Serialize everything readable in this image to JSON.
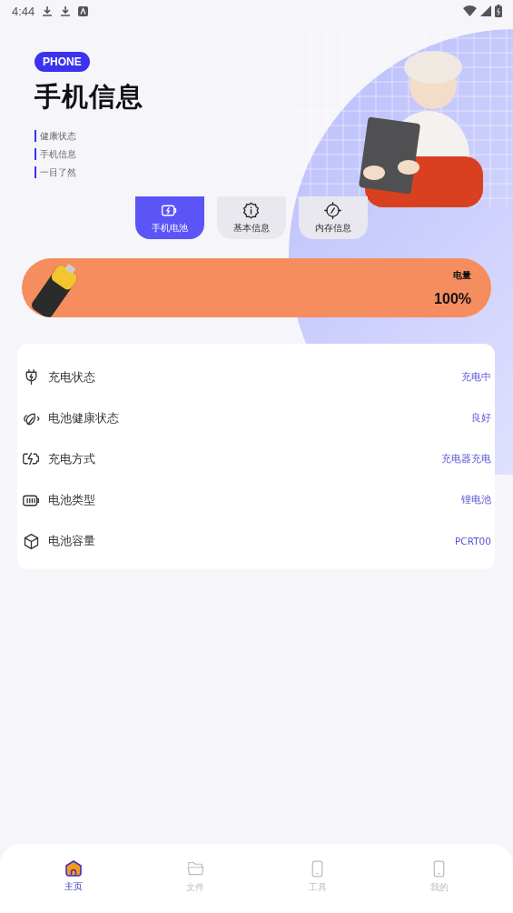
{
  "status_bar": {
    "time": "4:44"
  },
  "hero": {
    "badge": "PHONE",
    "title": "手机信息",
    "bullets": [
      "健康状态",
      "手机信息",
      "一目了然"
    ]
  },
  "tabs": [
    {
      "label": "手机电池",
      "selected": true
    },
    {
      "label": "基本信息",
      "selected": false
    },
    {
      "label": "内存信息",
      "selected": false
    }
  ],
  "battery": {
    "label": "电量",
    "value": "100%"
  },
  "info_rows": [
    {
      "label": "充电状态",
      "value": "充电中"
    },
    {
      "label": "电池健康状态",
      "value": "良好"
    },
    {
      "label": "充电方式",
      "value": "充电器充电"
    },
    {
      "label": "电池类型",
      "value": "锂电池"
    },
    {
      "label": "电池容量",
      "value": "PCRT00"
    }
  ],
  "bottom_nav": [
    {
      "label": "主页",
      "selected": true
    },
    {
      "label": "文件",
      "selected": false
    },
    {
      "label": "工具",
      "selected": false
    },
    {
      "label": "我的",
      "selected": false
    }
  ]
}
